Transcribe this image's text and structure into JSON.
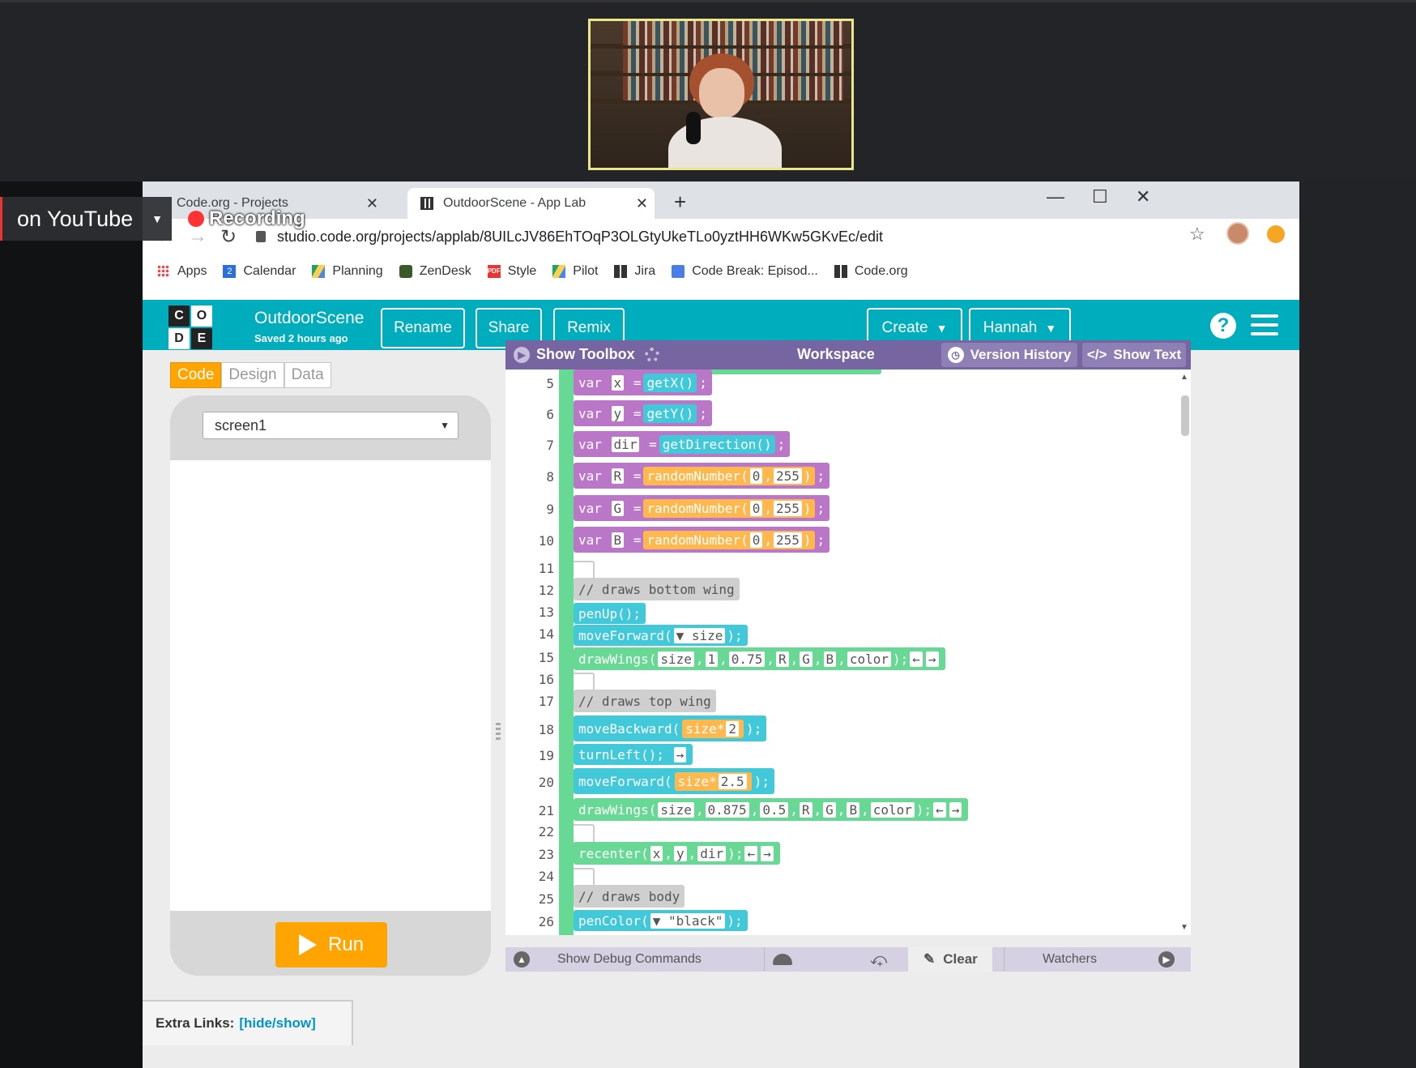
{
  "overlay": {
    "youtube_badge": "on YouTube",
    "recording": "Recording"
  },
  "browser": {
    "tabs": [
      {
        "title": "Code.org - Projects"
      },
      {
        "title": "OutdoorScene - App Lab"
      }
    ],
    "new_tab": "+",
    "url": "studio.code.org/projects/applab/8UILcJV86EhTOqP3OLGtyUkeTLo0yztHH6WKw5GKvEc/edit",
    "bookmarks": [
      "Apps",
      "Calendar",
      "Planning",
      "ZenDesk",
      "Style",
      "Pilot",
      "Jira",
      "Code Break: Episod...",
      "Code.org"
    ],
    "calendar_badge": "2",
    "style_badge": "PDF"
  },
  "app": {
    "logo_letters": [
      "C",
      "O",
      "D",
      "E"
    ],
    "project_name": "OutdoorScene",
    "saved": "Saved 2 hours ago",
    "buttons": {
      "rename": "Rename",
      "share": "Share",
      "remix": "Remix",
      "create": "Create",
      "user": "Hannah"
    },
    "help": "?",
    "modes": [
      "Code",
      "Design",
      "Data"
    ],
    "screen_select": "screen1",
    "run": "Run",
    "extra_links_label": "Extra Links:",
    "extra_links_link": "[hide/show]"
  },
  "workspace": {
    "show_toolbox": "Show Toolbox",
    "title": "Workspace",
    "version_history": "Version History",
    "show_text": "Show Text",
    "line_numbers": [
      "5",
      "6",
      "7",
      "8",
      "9",
      "10",
      "11",
      "12",
      "13",
      "14",
      "15",
      "16",
      "17",
      "18",
      "19",
      "20",
      "21",
      "22",
      "23",
      "24",
      "25",
      "26"
    ],
    "kw_var": "var",
    "eq": "=",
    "semi": ";",
    "l5": {
      "name": "x",
      "call": "getX()"
    },
    "l6": {
      "name": "y",
      "call": "getY()"
    },
    "l7": {
      "name": "dir",
      "call": "getDirection()"
    },
    "l8": {
      "name": "R",
      "fn": "randomNumber",
      "a": "0",
      "b": "255"
    },
    "l9": {
      "name": "G",
      "fn": "randomNumber",
      "a": "0",
      "b": "255"
    },
    "l10": {
      "name": "B",
      "fn": "randomNumber",
      "a": "0",
      "b": "255"
    },
    "l12": "// draws bottom wing",
    "l13": "penUp();",
    "l14": {
      "fn": "moveForward",
      "arg": "▼ size"
    },
    "l15": {
      "fn": "drawWings",
      "args": [
        "size",
        "1",
        "0.75",
        "R",
        "G",
        "B",
        "color"
      ]
    },
    "l17": "// draws top wing",
    "l18": {
      "fn": "moveBackward",
      "arg": "size",
      "op": "*",
      "num": "2"
    },
    "l19": "turnLeft();",
    "l20": {
      "fn": "moveForward",
      "arg": "size",
      "op": "*",
      "num": "2.5"
    },
    "l21": {
      "fn": "drawWings",
      "args": [
        "size",
        "0.875",
        "0.5",
        "R",
        "G",
        "B",
        "color"
      ]
    },
    "l23": {
      "fn": "recenter",
      "args": [
        "x",
        "y",
        "dir"
      ]
    },
    "l25": "// draws body",
    "l26": {
      "fn": "penColor",
      "arg": "▼ \"black\""
    }
  },
  "debug": {
    "show_debug": "Show Debug Commands",
    "clear": "Clear",
    "watchers": "Watchers"
  },
  "colors": {
    "header_teal": "#00adbc",
    "workspace_purple": "#7665a0",
    "run_orange": "#ffa400",
    "block_purple": "#bb77c7",
    "block_green": "#68d995",
    "block_teal": "#41c9d9"
  }
}
